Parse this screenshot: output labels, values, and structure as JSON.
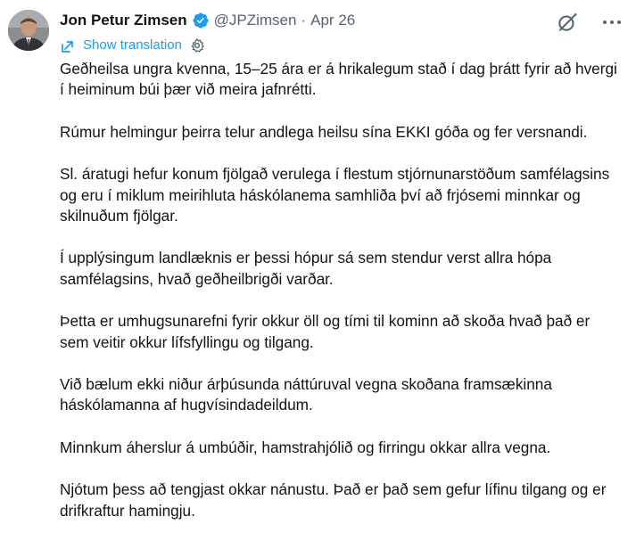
{
  "tweet": {
    "author_name": "Jon Petur Zimsen",
    "handle": "@JPZimsen",
    "separator": "·",
    "date": "Apr 26",
    "show_translation": "Show translation",
    "paragraphs": [
      "Geðheilsa ungra kvenna, 15–25 ára er á hrikalegum stað í dag þrátt fyrir að hvergi í heiminum búi þær við meira jafnrétti.",
      "Rúmur helmingur þeirra telur andlega heilsu sína EKKI góða og fer versnandi.",
      "Sl. áratugi hefur konum fjölgað verulega í flestum stjórnunarstöðum samfélagsins og eru í miklum meirihluta háskólanema samhliða því að frjósemi minnkar og skilnuðum fjölgar.",
      "Í upplýsingum landlæknis er þessi hópur sá sem stendur verst allra hópa samfélagsins, hvað geðheilbrigði varðar.",
      "Þetta er umhugsunarefni fyrir okkur öll og tími til kominn að skoða hvað það er sem veitir okkur lífsfyllingu og tilgang.",
      "Við bælum ekki niður árþúsunda náttúruval vegna skoðana framsækinna háskólamanna af hugvísindadeildum.",
      "Minnkum áherslur á umbúðir, hamstrahjólið og firringu okkar allra vegna.",
      "Njótum þess að tengjast okkar nánustu. Það er það sem gefur lífinu tilgang og er drifkraftur hamingju."
    ]
  },
  "icons": {
    "verified": "verified-badge-icon",
    "grok": "grok-icon",
    "more": "more-options-icon",
    "translate": "translate-icon",
    "settings": "gear-icon"
  },
  "colors": {
    "text": "#0f1419",
    "secondary": "#536471",
    "link": "#1d9bf0",
    "verified": "#1d9bf0"
  }
}
